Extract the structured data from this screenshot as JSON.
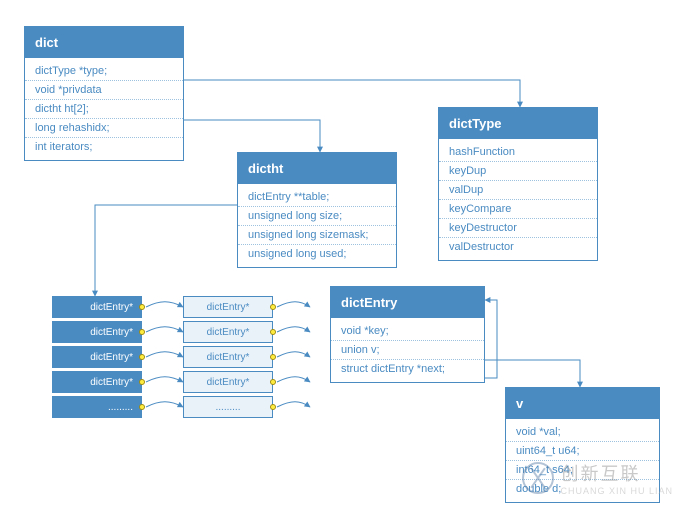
{
  "structs": {
    "dict": {
      "title": "dict",
      "fields": [
        "dictType *type;",
        "void *privdata",
        "dictht ht[2];",
        "long rehashidx;",
        "int iterators;"
      ]
    },
    "dictht": {
      "title": "dictht",
      "fields": [
        "dictEntry **table;",
        "unsigned long size;",
        "unsigned long sizemask;",
        "unsigned long used;"
      ]
    },
    "dictType": {
      "title": "dictType",
      "fields": [
        "hashFunction",
        "keyDup",
        "valDup",
        "keyCompare",
        "keyDestructor",
        "valDestructor"
      ]
    },
    "dictEntry": {
      "title": "dictEntry",
      "fields": [
        "void *key;",
        "union v;",
        "struct dictEntry *next;"
      ]
    },
    "v": {
      "title": "v",
      "fields": [
        "void *val;",
        "uint64_t u64;",
        "int64_t s64;",
        "double d;"
      ]
    }
  },
  "array": {
    "label": "dictEntry*",
    "ellipsis": "........."
  },
  "watermark": {
    "text": "创新互联",
    "sub": "CHUANG XIN HU LIAN"
  }
}
